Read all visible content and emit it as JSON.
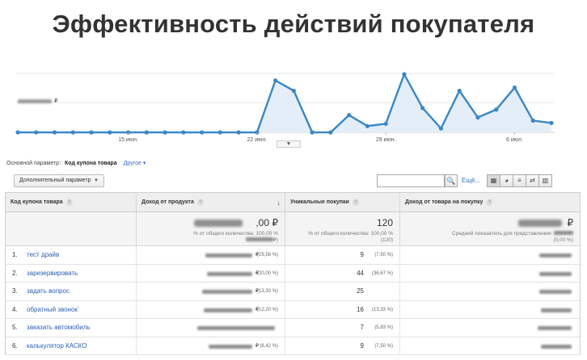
{
  "title": "Эффективность действий покупателя",
  "chart": {
    "y_label_currency": "₽",
    "x_ticks": [
      "15 июн.",
      "22 июн.",
      "29 июн.",
      "6 июл."
    ],
    "values": [
      0,
      0,
      0,
      0,
      0,
      0,
      0,
      0,
      0,
      0,
      0,
      0,
      0,
      0,
      66,
      53,
      0,
      0,
      22,
      8,
      11,
      74,
      31,
      5,
      53,
      19,
      29,
      57,
      15,
      12
    ],
    "handle": "▼",
    "line_color": "#3a87c4",
    "fill_color": "#e3eef9"
  },
  "params": {
    "label": "Основной параметр:",
    "main": "Код купона товара",
    "other": "Другое ▾"
  },
  "controls": {
    "secondary_dim": "Дополнительный параметр",
    "caret": "▼",
    "search_icon": "🔍",
    "more": "Ещё..."
  },
  "views": [
    "▦",
    "◕",
    "≡",
    "⇄",
    "▥"
  ],
  "table": {
    "headers": {
      "c1": "Код купона товара",
      "c2": "Доход от продукта",
      "c3": "Уникальные покупки",
      "c4": "Доход от товара на покупку"
    },
    "help_icon": "?",
    "sort_icon": "↓",
    "totals": {
      "c2_value": ",00 ₽",
      "c2_sub1": "% от общего количества: 100,00 %",
      "c2_sub2": "₽)",
      "c3_value": "120",
      "c3_sub1": "% от общего количества: 100,00 %",
      "c3_sub2": "(120)",
      "c4_value": "₽",
      "c4_sub1": "Средний показатель для представления:",
      "c4_sub2": "(0,00 %)"
    },
    "rows": [
      {
        "num": "1.",
        "name": "тест драйв",
        "rub": "₽",
        "rev_pct": "(29,56 %)",
        "uniq": "9",
        "uniq_pct": "(7,50 %)"
      },
      {
        "num": "2.",
        "name": "зарезервировать",
        "rub": "₽",
        "rev_pct": "(20,00 %)",
        "uniq": "44",
        "uniq_pct": "(36,67 %)"
      },
      {
        "num": "3.",
        "name": "задать вопрос",
        "rub": "₽",
        "rev_pct": "(13,30 %)",
        "uniq": "25",
        "uniq_pct": ""
      },
      {
        "num": "4.",
        "name": "обратный звонок`",
        "rub": "₽",
        "rev_pct": "(12,20 %)",
        "uniq": "16",
        "uniq_pct": "(13,33 %)"
      },
      {
        "num": "5.",
        "name": "заказать автомобиль",
        "rub": "",
        "rev_pct": "",
        "uniq": "7",
        "uniq_pct": "(5,83 %)"
      },
      {
        "num": "6.",
        "name": "калькулятор КАСКО",
        "rub": "₽",
        "rev_pct": "(8,42 %)",
        "uniq": "9",
        "uniq_pct": "(7,50 %)"
      }
    ]
  }
}
